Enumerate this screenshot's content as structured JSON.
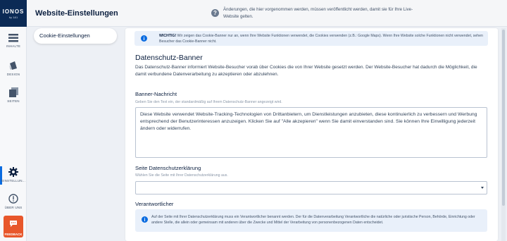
{
  "rail": {
    "logo": "IONOS",
    "logo_sub": "by 1&1",
    "items": [
      {
        "label": "INHALTE",
        "icon": "content-icon"
      },
      {
        "label": "DESIGN",
        "icon": "design-icon"
      },
      {
        "label": "SEITEN",
        "icon": "pages-icon"
      },
      {
        "label": "EINSTELLUN...",
        "icon": "gear-icon"
      },
      {
        "label": "ÜBER UNS",
        "icon": "alert-icon"
      }
    ],
    "feedback": "FEEDBACK",
    "accent": "#0b6ce0",
    "feedback_color": "#e8572b"
  },
  "header": {
    "title": "Website-Einstellungen",
    "notice_line1": "Änderungen, die hier vorgenommen werden, müssen veröffentlicht werden, damit sie für Ihre Live-",
    "notice_line2": "Website gelten."
  },
  "subnav": {
    "item": "Cookie-Einstellungen"
  },
  "warning": {
    "bold": "WICHTIG!",
    "text": " Wir zeigen das Cookie-Banner nur an, wenn Ihre Website Funktionen verwendet, die Cookies verwenden (z.B.: Google Maps). Wenn Ihre Website solche Funktionen nicht verwendet, sehen Besucher das Cookie-Banner nicht."
  },
  "section": {
    "title": "Datenschutz-Banner",
    "description": "Das Datenschutz-Banner informiert Website-Besucher vorab über Cookies die von Ihrer Website gesetzt werden. Der Website-Besucher hat dadurch die Möglichkeit, die damit verbundene Datenverarbeitung zu akzeptieren oder abzulehnen."
  },
  "banner_message": {
    "label": "Banner-Nachricht",
    "hint": "Geben Sie den Text ein, der standardmäßig auf Ihrem Datenschutz-Banner angezeigt wird.",
    "value": "Diese Website verwendet Website-Tracking-Technologien von Drittanbietern, um Dienstleistungen anzubieten, diese kontinuierlich zu verbessern und Werbung entsprechend der Benutzerinteressen anzuzeigen. Klicken Sie auf \"Alle akzepieren\" wenn Sie damit einverstanden sind. Sie können Ihre Einwilligung jederzeit ändern oder widerrufen."
  },
  "privacy_page": {
    "label": "Seite Datenschutzerklärung",
    "hint": "Wählen Sie die Seite mit Ihrer Datenschutzerklärung aus.",
    "value": ""
  },
  "responsible": {
    "label": "Verantwortlicher",
    "info": "Auf der Seite mit Ihrer Datenschutzerklärung muss ein Verantwortlicher benannt werden. Der für die Datenverarbeitung Verantwortliche die natürliche oder juristische Person, Behörde, Einrichtung oder andere Stelle, die allein oder gemeinsam mit anderen über die Zwecke und Mittel der Verarbeitung von personenbezogenen Daten entscheidet."
  }
}
